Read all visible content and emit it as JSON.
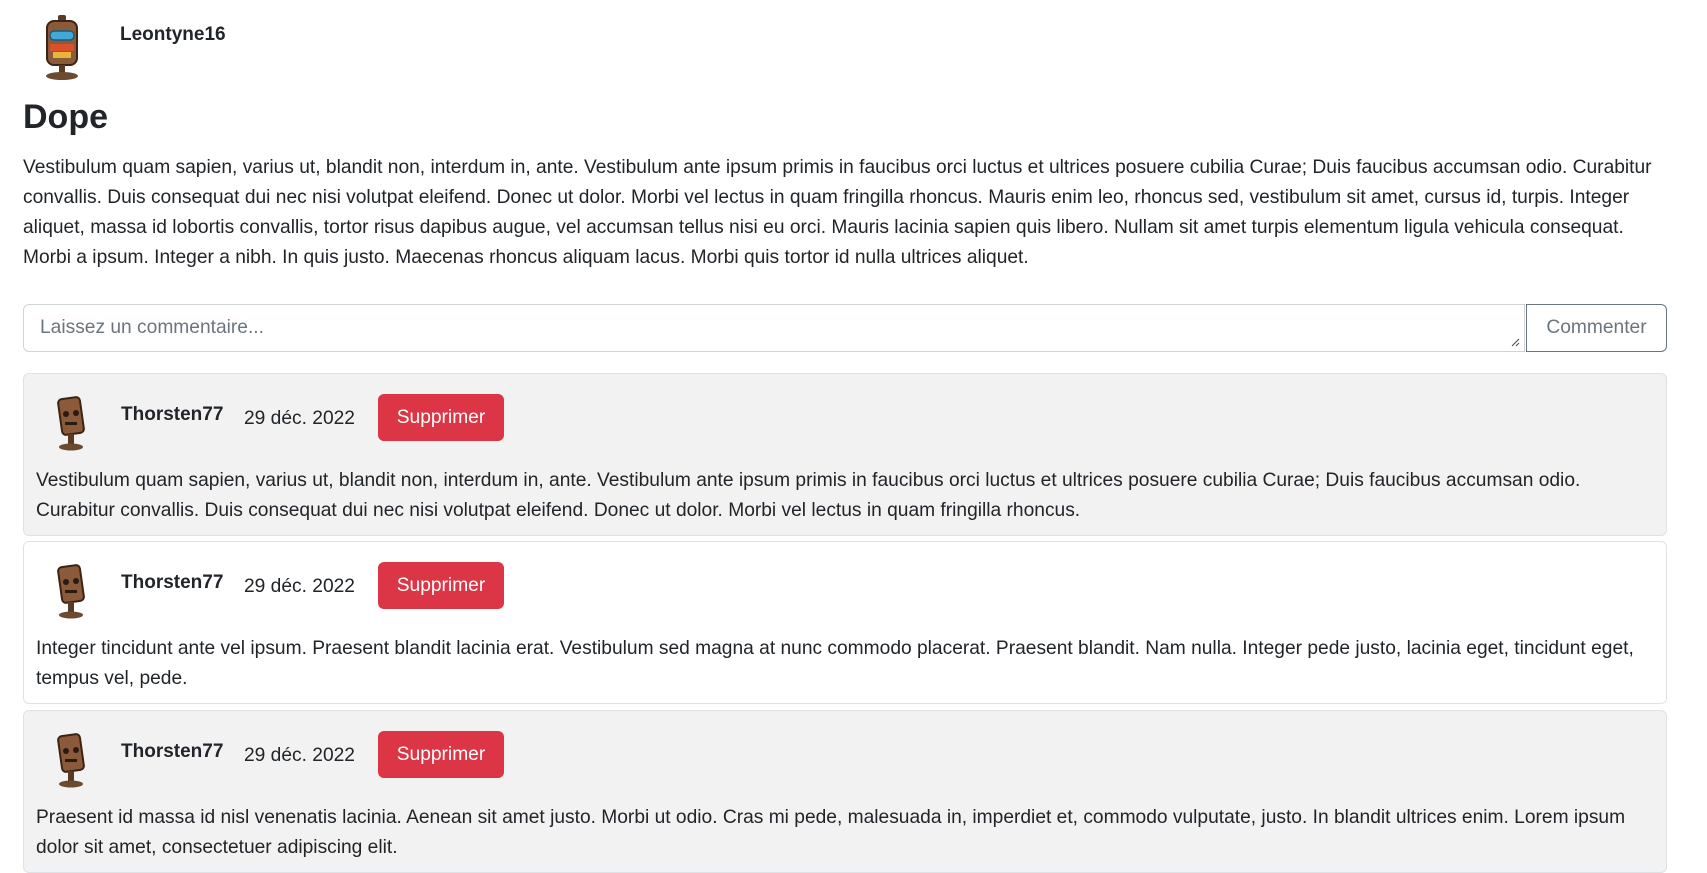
{
  "post": {
    "author": "Leontyne16",
    "title": "Dope",
    "body": "Vestibulum quam sapien, varius ut, blandit non, interdum in, ante. Vestibulum ante ipsum primis in faucibus orci luctus et ultrices posuere cubilia Curae; Duis faucibus accumsan odio. Curabitur convallis. Duis consequat dui nec nisi volutpat eleifend. Donec ut dolor. Morbi vel lectus in quam fringilla rhoncus. Mauris enim leo, rhoncus sed, vestibulum sit amet, cursus id, turpis. Integer aliquet, massa id lobortis convallis, tortor risus dapibus augue, vel accumsan tellus nisi eu orci. Mauris lacinia sapien quis libero. Nullam sit amet turpis elementum ligula vehicula consequat. Morbi a ipsum. Integer a nibh. In quis justo. Maecenas rhoncus aliquam lacus. Morbi quis tortor id nulla ultrices aliquet."
  },
  "comment_form": {
    "placeholder": "Laissez un commentaire...",
    "button_label": "Commenter"
  },
  "comments": [
    {
      "user": "Thorsten77",
      "date": "29 déc. 2022",
      "delete_label": "Supprimer",
      "text": "Vestibulum quam sapien, varius ut, blandit non, interdum in, ante. Vestibulum ante ipsum primis in faucibus orci luctus et ultrices posuere cubilia Curae; Duis faucibus accumsan odio. Curabitur convallis. Duis consequat dui nec nisi volutpat eleifend. Donec ut dolor. Morbi vel lectus in quam fringilla rhoncus."
    },
    {
      "user": "Thorsten77",
      "date": "29 déc. 2022",
      "delete_label": "Supprimer",
      "text": "Integer tincidunt ante vel ipsum. Praesent blandit lacinia erat. Vestibulum sed magna at nunc commodo placerat. Praesent blandit. Nam nulla. Integer pede justo, lacinia eget, tincidunt eget, tempus vel, pede."
    },
    {
      "user": "Thorsten77",
      "date": "29 déc. 2022",
      "delete_label": "Supprimer",
      "text": "Praesent id massa id nisl venenatis lacinia. Aenean sit amet justo. Morbi ut odio. Cras mi pede, malesuada in, imperdiet et, commodo vulputate, justo. In blandit ultrices enim. Lorem ipsum dolor sit amet, consectetuer adipiscing elit."
    }
  ],
  "colors": {
    "danger": "#dc3545",
    "shaded_card": "#f2f2f2",
    "border": "#dee2e6",
    "muted": "#6c757d"
  },
  "icons": {
    "author_avatar": "robot-avatar-icon",
    "comment_avatar": "robot-avatar-icon",
    "resize": "resize-grip-icon"
  }
}
